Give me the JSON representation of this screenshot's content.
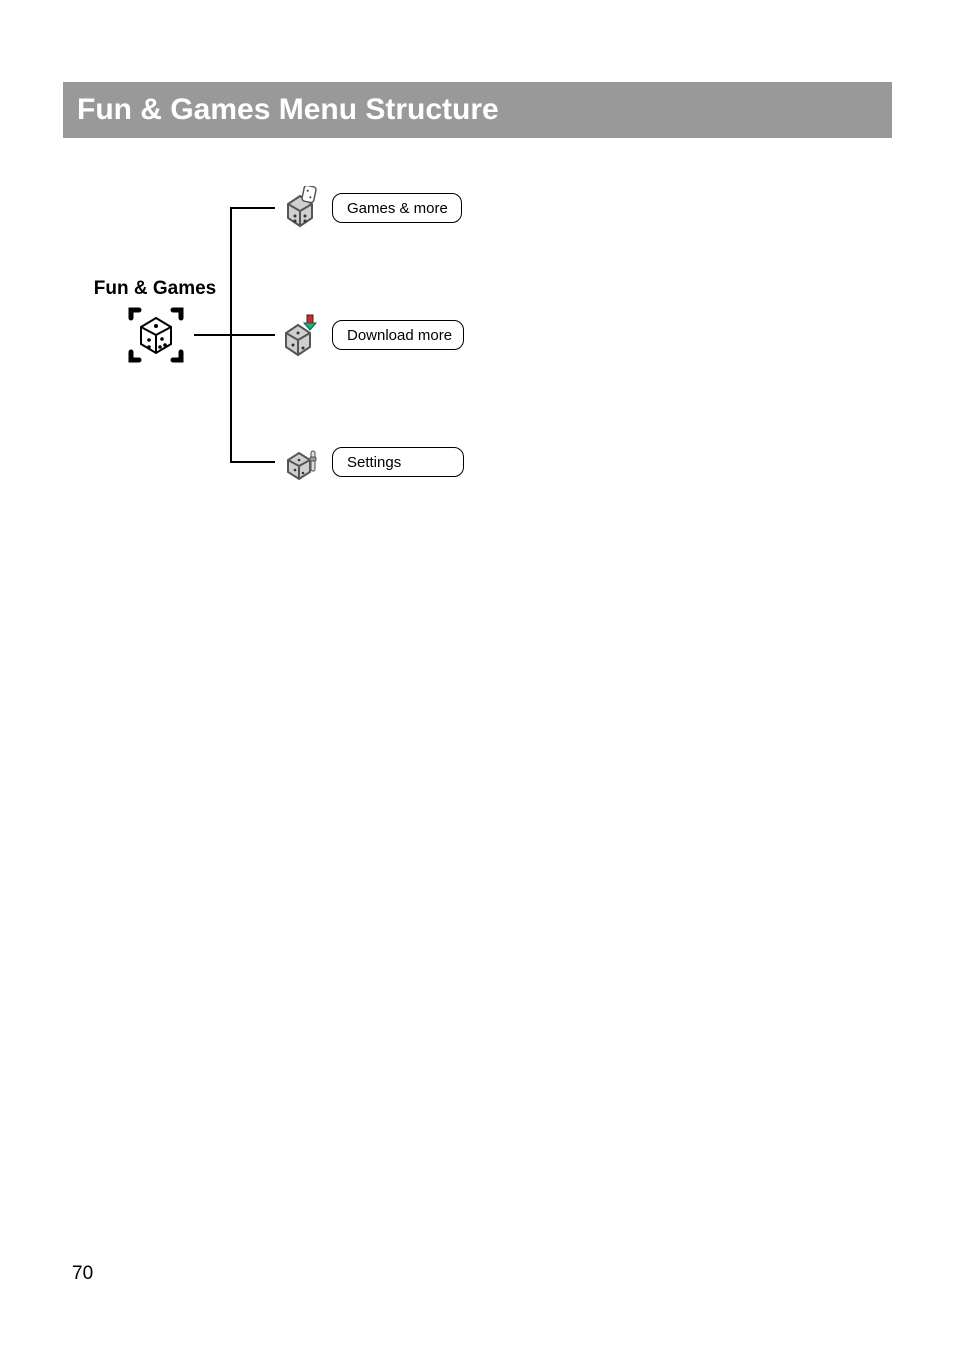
{
  "title": "Fun & Games Menu Structure",
  "root": {
    "label": "Fun & Games"
  },
  "items": [
    {
      "label": "Games & more"
    },
    {
      "label": "Download more"
    },
    {
      "label": "Settings"
    }
  ],
  "page_number": "70"
}
